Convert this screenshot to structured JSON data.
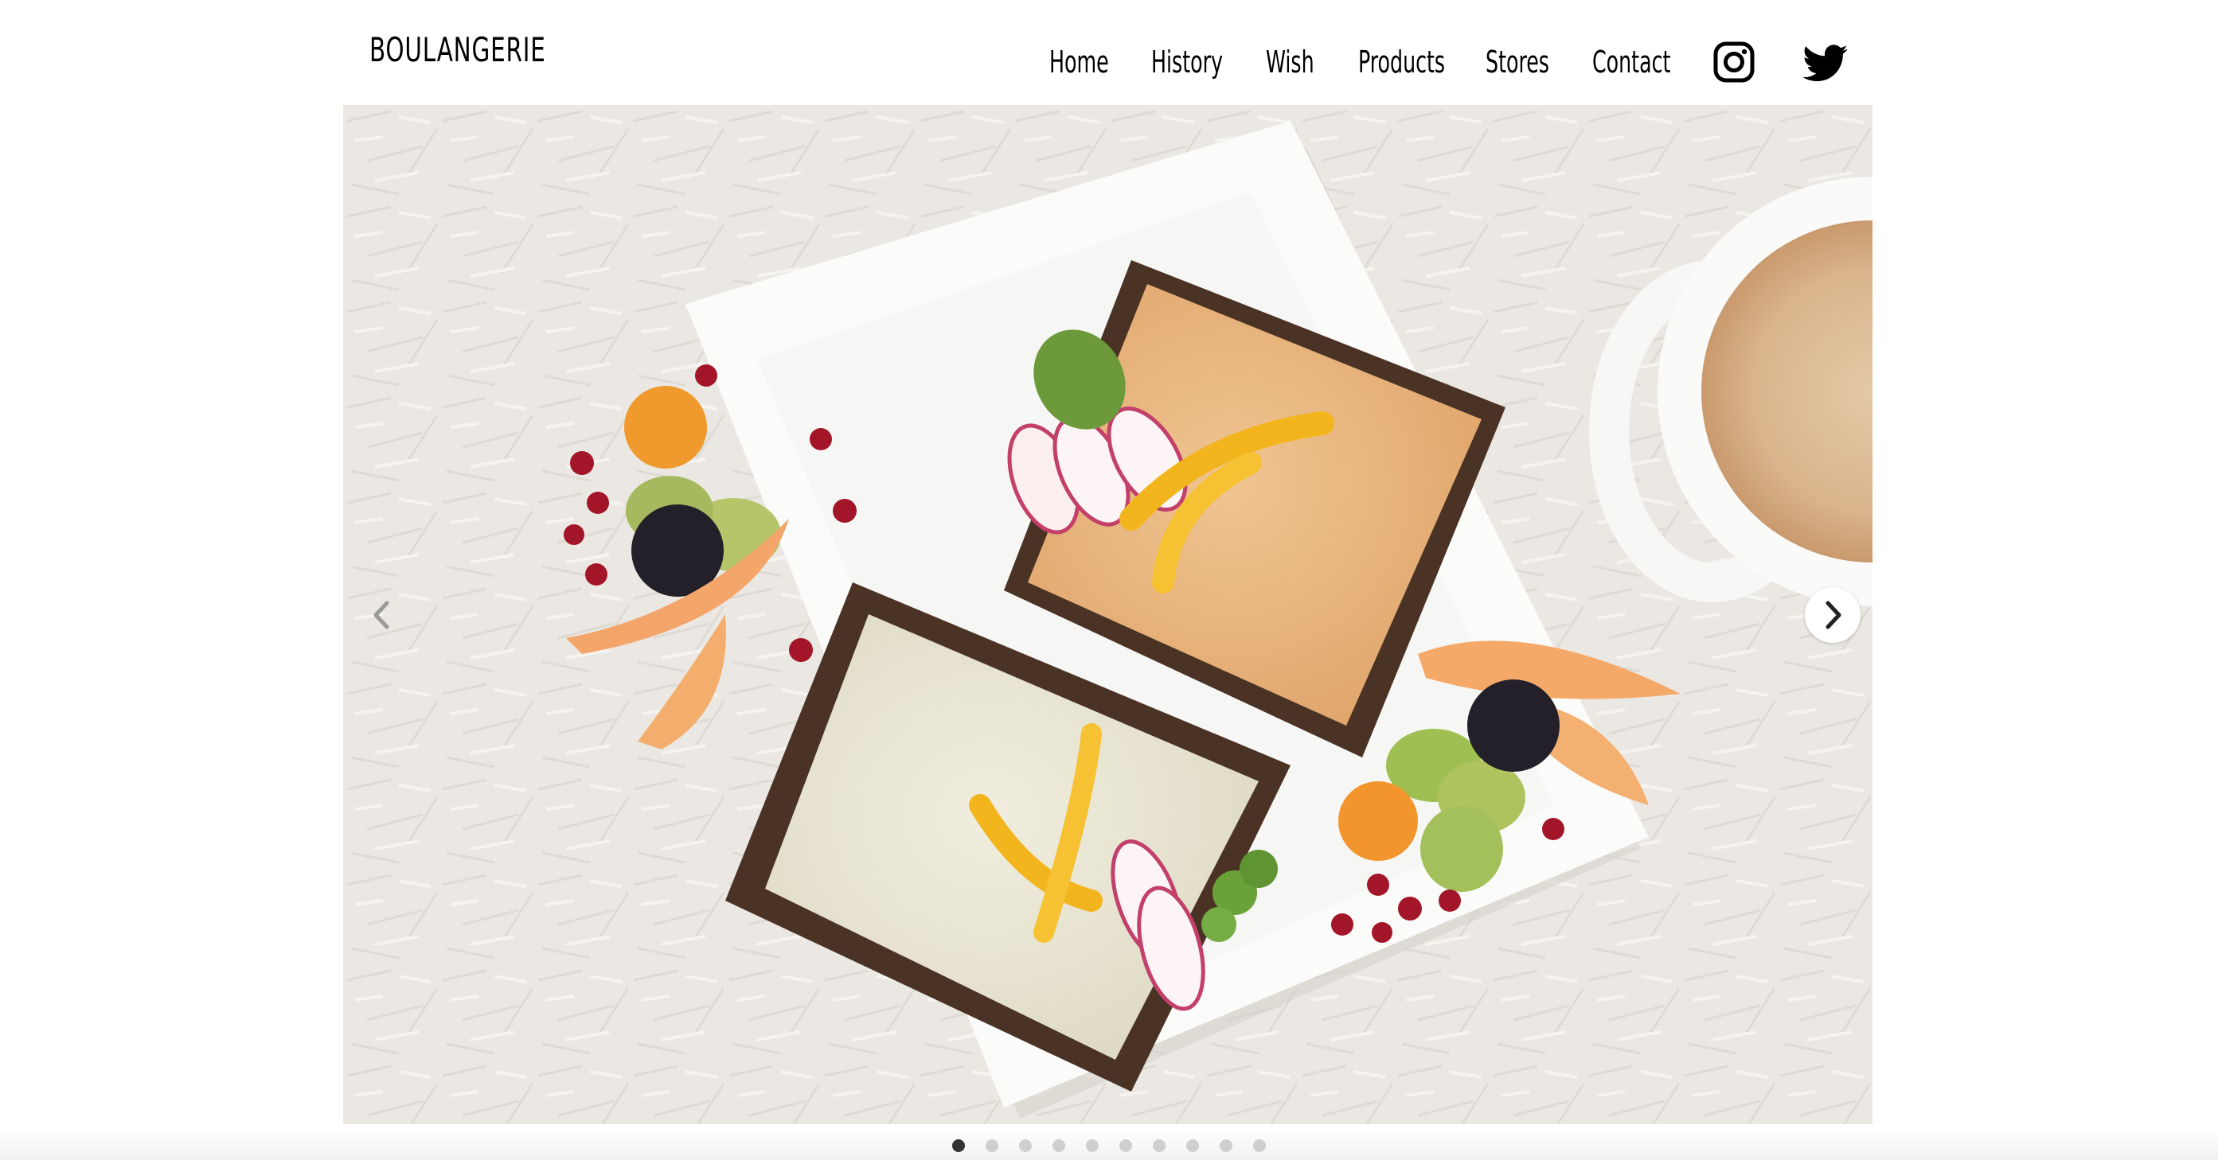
{
  "header": {
    "brand": "BOULANGERIE",
    "nav": [
      {
        "label": "Home"
      },
      {
        "label": "History"
      },
      {
        "label": "Wish"
      },
      {
        "label": "Products"
      },
      {
        "label": "Stores"
      },
      {
        "label": "Contact"
      }
    ],
    "social": [
      {
        "icon": "instagram-icon"
      },
      {
        "icon": "twitter-icon"
      }
    ]
  },
  "slider": {
    "image": "breakfast toast plate",
    "prev_icon": "chevron-left-icon",
    "next_icon": "chevron-right-icon",
    "slide_count": 10,
    "active_index": 0
  },
  "colors": {
    "text": "#000000",
    "dot_active": "#333333",
    "dot_inactive": "#cfcfcf"
  }
}
